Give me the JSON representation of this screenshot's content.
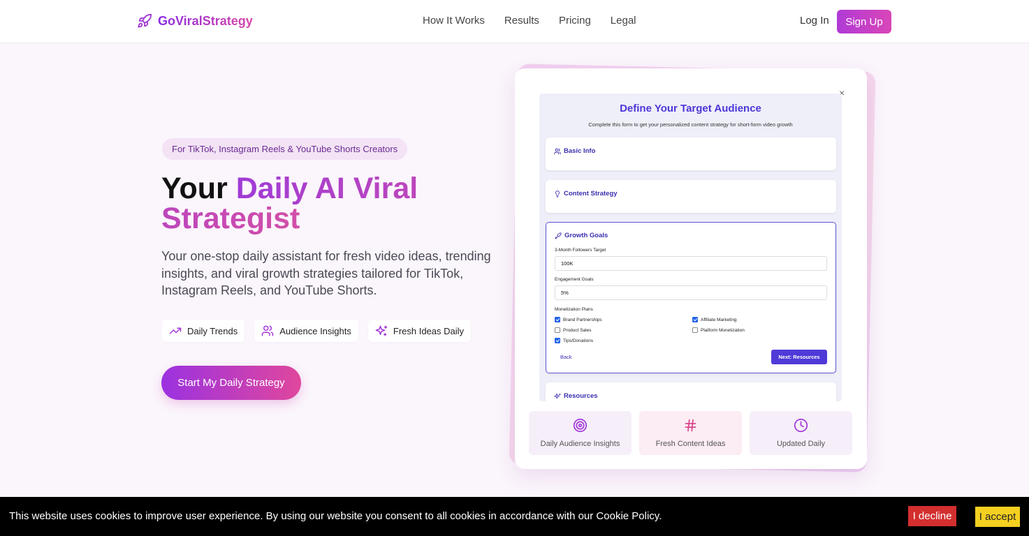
{
  "nav": {
    "brand": "GoViralStrategy",
    "links": [
      "How It Works",
      "Results",
      "Pricing",
      "Legal"
    ],
    "login": "Log In",
    "signup": "Sign Up"
  },
  "hero": {
    "pill": "For TikTok, Instagram Reels & YouTube Shorts Creators",
    "title_plain": "Your ",
    "title_gradient": "Daily AI Viral Strategist",
    "description": "Your one-stop daily assistant for fresh video ideas, trending insights, and viral growth strategies tailored for TikTok, Instagram Reels, and YouTube Shorts.",
    "features": [
      "Daily Trends",
      "Audience Insights",
      "Fresh Ideas Daily"
    ],
    "cta": "Start My Daily Strategy"
  },
  "form": {
    "title": "Define Your Target Audience",
    "subtitle": "Complete this form to get your personalized content strategy for short-form video growth",
    "sections": {
      "basic": "Basic Info",
      "content": "Content Strategy",
      "growth": "Growth Goals",
      "resources": "Resources"
    },
    "followers_label": "3-Month Followers Target",
    "followers_value": "100K",
    "engagement_label": "Engagement Goals",
    "engagement_value": "5%",
    "monetization_label": "Monetization Plans",
    "monetization": [
      {
        "label": "Brand Partnerships",
        "checked": true
      },
      {
        "label": "Affiliate Marketing",
        "checked": true
      },
      {
        "label": "Product Sales",
        "checked": false
      },
      {
        "label": "Platform Monetization",
        "checked": false
      },
      {
        "label": "Tips/Donations",
        "checked": true
      }
    ],
    "back": "Back",
    "next": "Next: Resources",
    "close": "×"
  },
  "stats": [
    "Daily Audience Insights",
    "Fresh Content Ideas",
    "Updated Daily"
  ],
  "cookie": {
    "text": "This website uses cookies to improve user experience. By using our website you consent to all cookies in accordance with our Cookie Policy.",
    "decline": "I decline",
    "accept": "I accept"
  },
  "colors": {
    "brand_purple": "#8a2be2",
    "brand_pink": "#d946a8",
    "form_accent": "#4b37d8",
    "decline": "#d32f2f",
    "accept": "#f5d020"
  }
}
